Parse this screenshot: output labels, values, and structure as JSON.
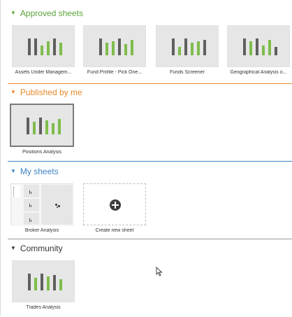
{
  "colors": {
    "approved": "#5aa339",
    "published": "#e8892a",
    "my_sheets": "#3b82c4",
    "community": "#333333"
  },
  "sections": {
    "approved": {
      "title": "Approved sheets",
      "sheets": [
        {
          "label": "Assets Under Managem..."
        },
        {
          "label": "Fund Profile - Pick One..."
        },
        {
          "label": "Funds Screener"
        },
        {
          "label": "Geographical Analysis o..."
        }
      ]
    },
    "published": {
      "title": "Published by me",
      "sheets": [
        {
          "label": "Positions Analysis"
        }
      ]
    },
    "my_sheets": {
      "title": "My sheets",
      "sheets": [
        {
          "label": "Broker Analysis"
        }
      ],
      "create_label": "Create new sheet"
    },
    "community": {
      "title": "Community",
      "sheets": [
        {
          "label": "Trades Analysis"
        }
      ]
    }
  },
  "icons": {
    "caret": "caret-down-icon",
    "plus": "plus-circle-icon",
    "cursor": "mouse-pointer-icon",
    "thumbnail": "bar-chart-icon"
  }
}
